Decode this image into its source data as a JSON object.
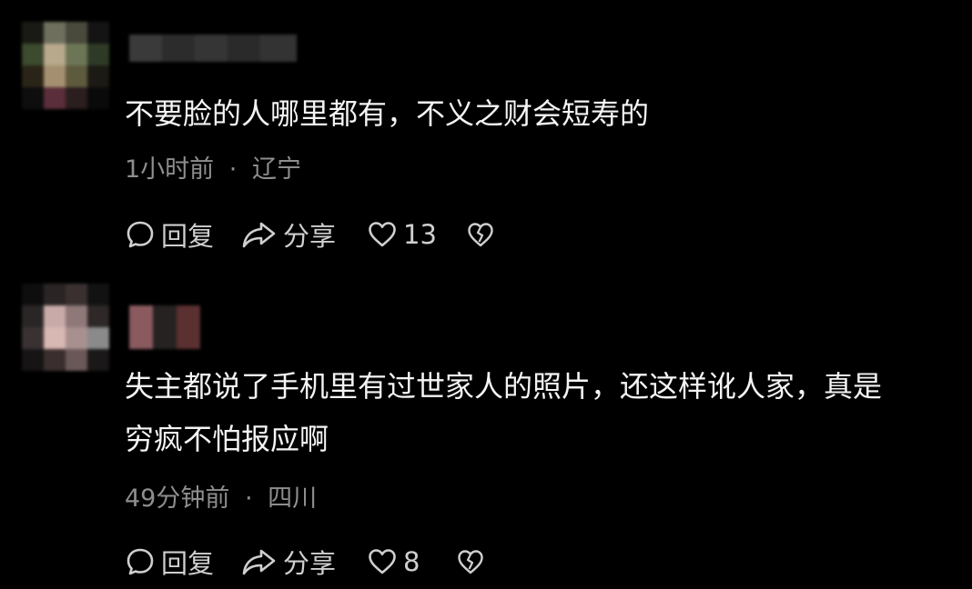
{
  "comments": [
    {
      "text_lines": [
        "不要脸的人哪里都有，不义之财会短寿的"
      ],
      "time": "1小时前",
      "separator": "·",
      "location": "辽宁",
      "reply_label": "回复",
      "share_label": "分享",
      "like_count": "13"
    },
    {
      "text_lines": [
        "失主都说了手机里有过世家人的照片，还这样讹人家，真是",
        "穷疯不怕报应啊"
      ],
      "time": "49分钟前",
      "separator": "·",
      "location": "四川",
      "reply_label": "回复",
      "share_label": "分享",
      "like_count": "8"
    }
  ],
  "icons": {
    "reply": "speech-bubble-icon",
    "share": "share-arrow-icon",
    "like": "heart-outline-icon",
    "dislike": "broken-heart-icon"
  },
  "colors": {
    "background": "#000000",
    "text": "#f4f4f4",
    "meta": "#8e8e8e",
    "action": "#cfcfcf"
  }
}
